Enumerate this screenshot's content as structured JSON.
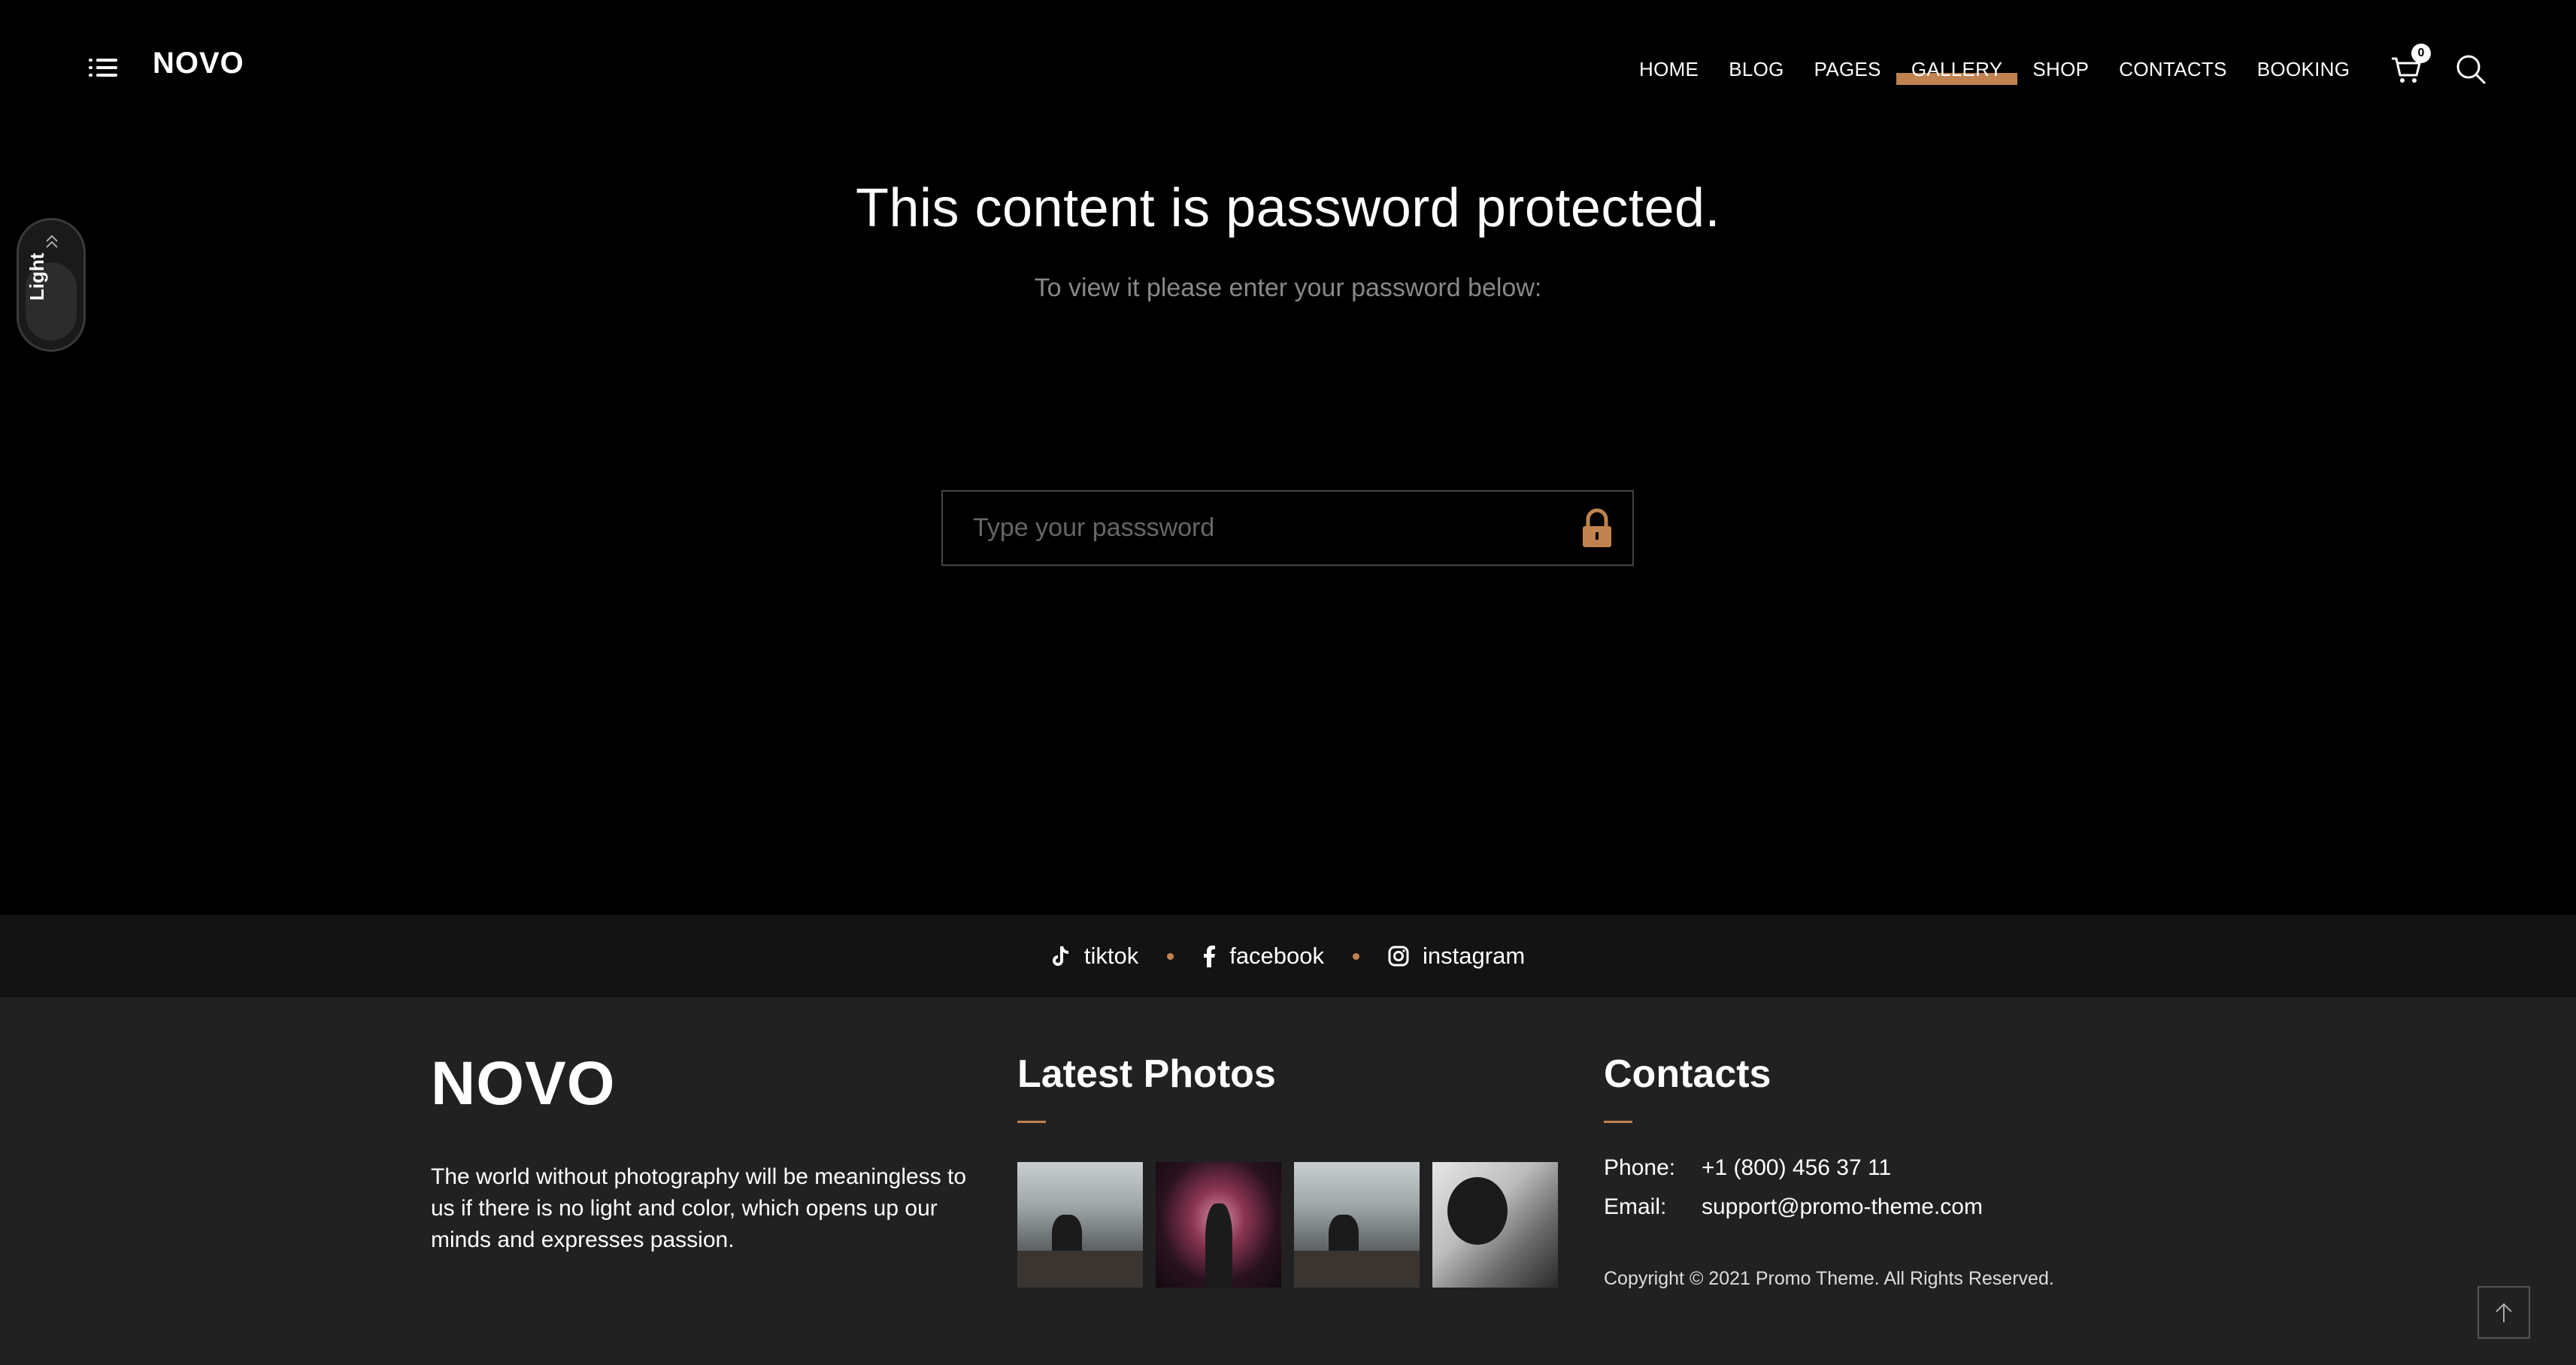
{
  "header": {
    "logo": "NOVO",
    "nav": [
      "HOME",
      "BLOG",
      "PAGES",
      "GALLERY",
      "SHOP",
      "CONTACTS",
      "BOOKING"
    ],
    "active_nav": "GALLERY",
    "cart_count": "0",
    "menu_icon": "hamburger-icon",
    "cart_icon": "cart-icon",
    "search_icon": "search-icon"
  },
  "side_toggle": {
    "label": "Light",
    "icon": "chevron-double-up-icon"
  },
  "main": {
    "title": "This content is password protected.",
    "subtitle": "To view it please enter your password below:",
    "password_placeholder": "Type your passsword",
    "lock_icon": "lock-icon"
  },
  "social": [
    {
      "label": "tiktok",
      "icon": "tiktok-icon"
    },
    {
      "label": "facebook",
      "icon": "facebook-icon"
    },
    {
      "label": "instagram",
      "icon": "instagram-icon"
    }
  ],
  "footer": {
    "logo": "NOVO",
    "about": "The world without photography will be meaningless to us if there is no light and color, which opens up our minds and expresses passion.",
    "photos_heading": "Latest Photos",
    "contacts_heading": "Contacts",
    "phone_label": "Phone:",
    "phone": "+1 (800) 456 37 11",
    "email_label": "Email:",
    "email": "support@promo-theme.com",
    "copyright": "Copyright © 2021 Promo Theme. All Rights Reserved."
  },
  "colors": {
    "accent": "#c0834f",
    "background": "#000000",
    "social_bar": "#131313",
    "footer": "#212121"
  }
}
